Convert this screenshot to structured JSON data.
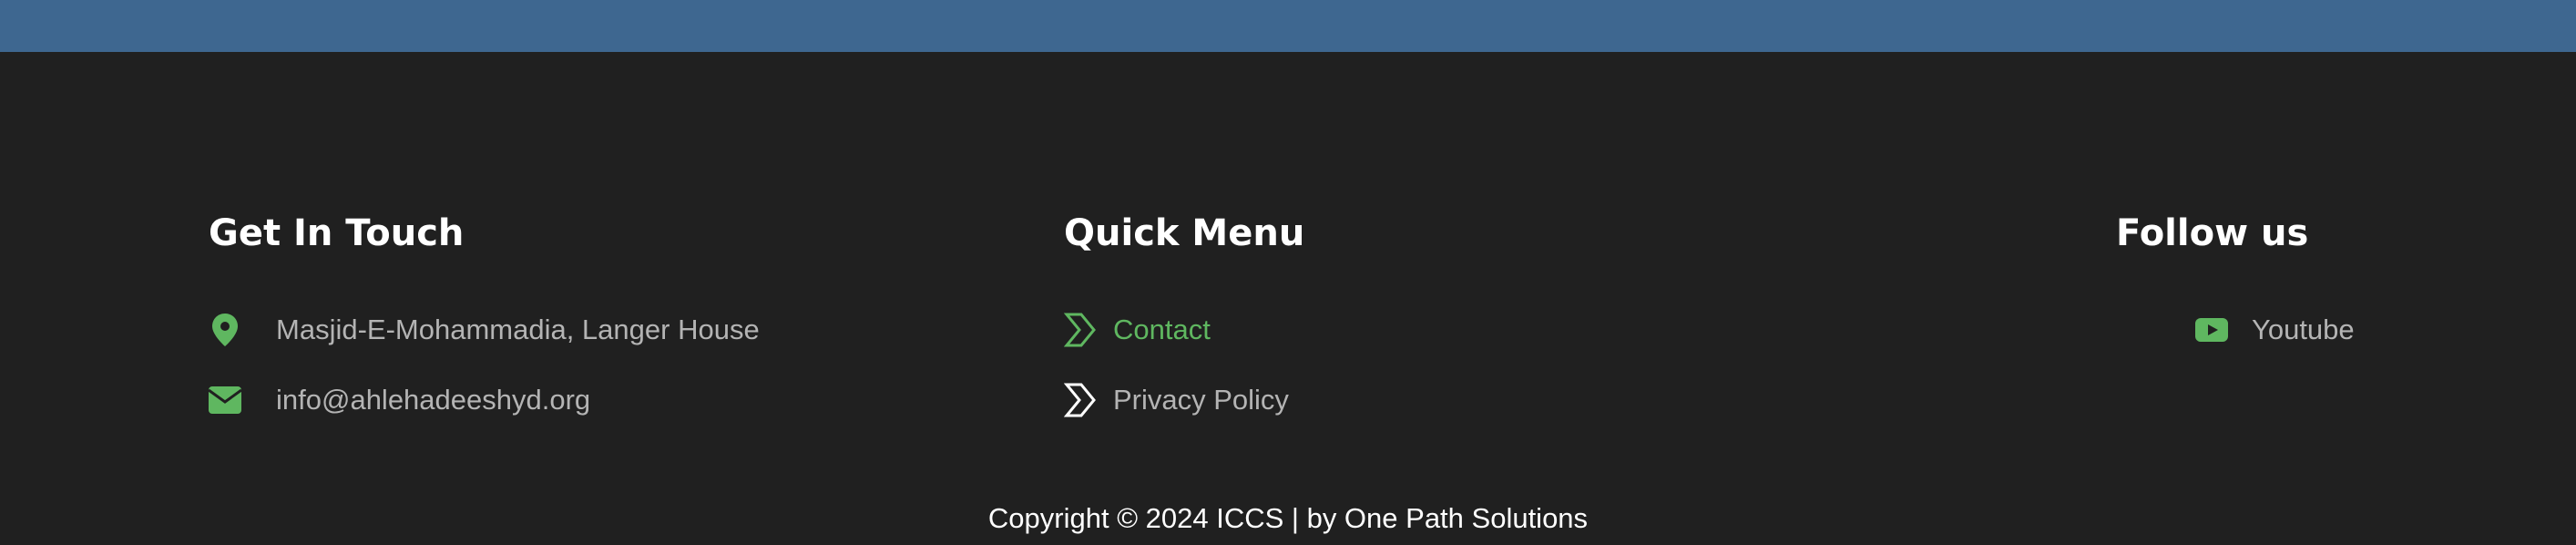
{
  "colors": {
    "topbar": "#3e6790",
    "background": "#202020",
    "accent": "#5fb760",
    "text_muted": "#b4b4b4",
    "heading": "#ffffff"
  },
  "contact": {
    "heading": "Get In Touch",
    "items": [
      {
        "icon": "map-marker-icon",
        "text": "Masjid-E-Mohammadia, Langer House"
      },
      {
        "icon": "envelope-icon",
        "text": "info@ahlehadeeshyd.org"
      }
    ]
  },
  "quick_menu": {
    "heading": "Quick Menu",
    "items": [
      {
        "icon": "chevron-right-icon",
        "label": "Contact",
        "active": true
      },
      {
        "icon": "chevron-right-icon",
        "label": "Privacy Policy",
        "active": false
      }
    ]
  },
  "social": {
    "heading": "Follow us",
    "items": [
      {
        "icon": "youtube-icon",
        "label": "Youtube"
      }
    ]
  },
  "copyright": "Copyright © 2024 ICCS  |  by One Path Solutions"
}
